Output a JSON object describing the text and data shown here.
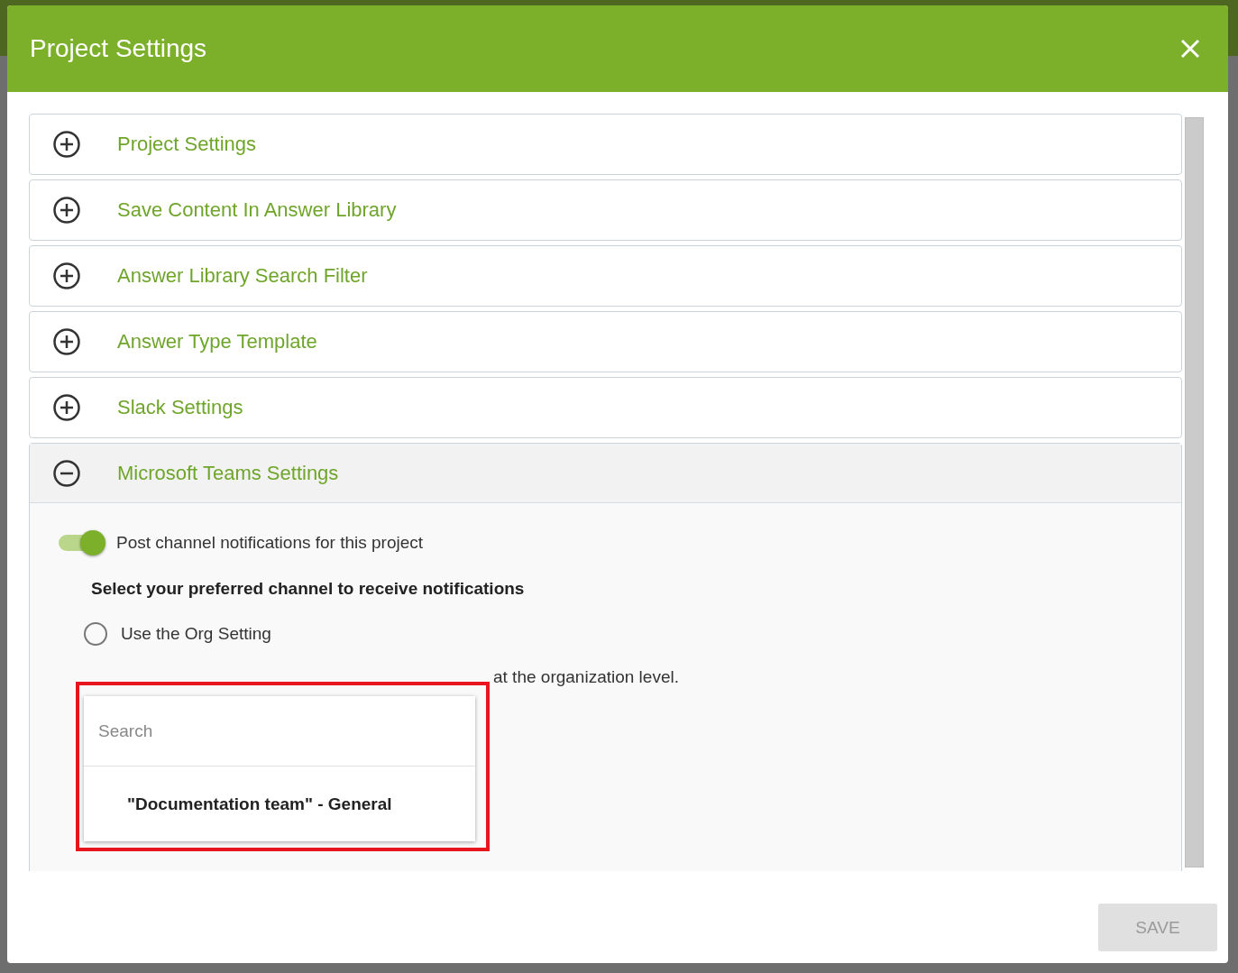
{
  "dialog": {
    "title": "Project Settings"
  },
  "sections": [
    {
      "title": "Project Settings",
      "expanded": false
    },
    {
      "title": "Save Content In Answer Library",
      "expanded": false
    },
    {
      "title": "Answer Library Search Filter",
      "expanded": false
    },
    {
      "title": "Answer Type Template",
      "expanded": false
    },
    {
      "title": "Slack Settings",
      "expanded": false
    },
    {
      "title": "Microsoft Teams Settings",
      "expanded": true
    }
  ],
  "teams_settings": {
    "toggle": {
      "label": "Post channel notifications for this project",
      "on": true
    },
    "heading": "Select your preferred channel to receive notifications",
    "options": [
      {
        "label": "Use the Org Setting",
        "selected": false
      }
    ],
    "org_note": "at the organization level.",
    "dropdown": {
      "search_placeholder": "Search",
      "items": [
        {
          "label": "\"Documentation team\" - General"
        }
      ]
    },
    "highlighted": true
  },
  "save_button": {
    "label": "SAVE",
    "disabled": true
  }
}
